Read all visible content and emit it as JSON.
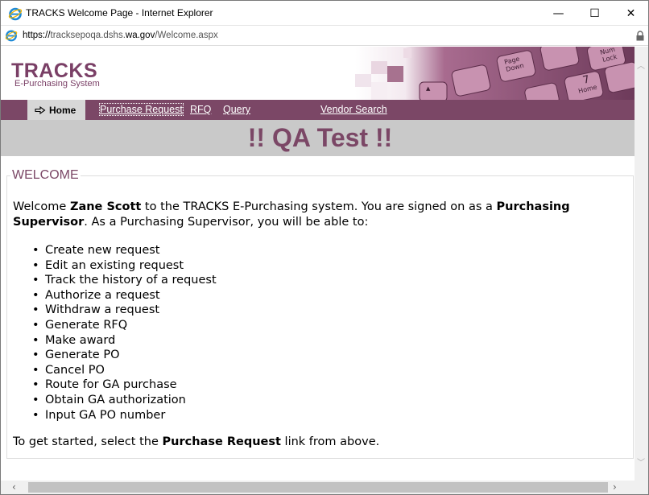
{
  "window": {
    "title": "TRACKS Welcome Page - Internet Explorer",
    "minimize_glyph": "—",
    "maximize_glyph": "☐",
    "close_glyph": "✕"
  },
  "address": {
    "scheme": "https://",
    "host_prefix": "trackse",
    "host_mid": "poqa",
    "host_suffix": ".dshs.",
    "host_domain": "wa.gov",
    "path": "/Welcome.aspx"
  },
  "branding": {
    "logo": "TRACKS",
    "subtitle": "E-Purchasing System"
  },
  "nav": {
    "home": "Home",
    "purchase_request": "Purchase Request",
    "rfq": "RFQ",
    "query": "Query",
    "vendor_search": "Vendor Search"
  },
  "banner_text": "!! QA Test !!",
  "welcome": {
    "heading": "WELCOME",
    "intro_1": "Welcome ",
    "user_name": "Zane Scott",
    "intro_2": " to the TRACKS E-Purchasing system. You are signed on as a ",
    "role": "Purchasing Supervisor",
    "intro_3": ". As a Purchasing Supervisor, you will be able to:",
    "tasks": [
      "Create new request",
      "Edit an existing request",
      "Track the history of a request",
      "Authorize a request",
      "Withdraw a request",
      "Generate RFQ",
      "Make award",
      "Generate PO",
      "Cancel PO",
      "Route for GA purchase",
      "Obtain GA authorization",
      "Input GA PO number"
    ],
    "outro_1": "To get started, select the ",
    "outro_link": "Purchase Request",
    "outro_2": " link from above."
  },
  "colors": {
    "brand": "#7b4766",
    "nav_bg": "#7b4766",
    "home_tab_bg": "#d7d7d7",
    "qa_band_bg": "#c9c9c9"
  },
  "icons": {
    "browser": "internet-explorer-icon",
    "lock": "lock-icon",
    "home_arrow": "arrow-right-icon"
  }
}
